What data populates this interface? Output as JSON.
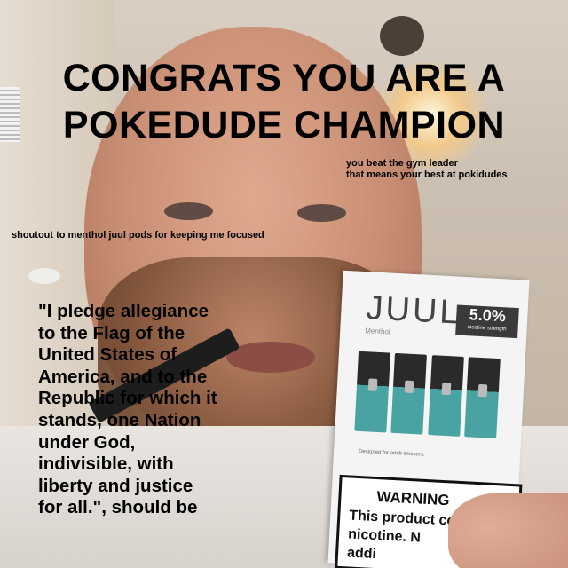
{
  "meme": {
    "title_lines": [
      "CONGRATS YOU ARE A",
      "POKEDUDE CHAMPION"
    ],
    "subnote_lines": [
      "you beat the gym leader",
      "that means your best at pokidudes"
    ],
    "shoutout": "shoutout to menthol juul pods for keeping me focused",
    "pledge_lines": [
      "\"I pledge allegiance",
      "to the Flag of the",
      "United States of",
      "America, and to the",
      "Republic for which it",
      "stands, one Nation",
      "under God,",
      "indivisible, with",
      "liberty and justice",
      "for all.\", should be"
    ]
  },
  "package": {
    "brand": "JUUL",
    "strength": "5.0%",
    "strength_sub": "nicotine strength",
    "flavor": "Menthol",
    "note": "Designed for adult smokers.",
    "warning_title": "WARNING",
    "warning_lines": [
      "This product co",
      "nicotine. N",
      "addi"
    ]
  },
  "colors": {
    "pod_accent": "#4aa3a3",
    "text": "#000000"
  }
}
